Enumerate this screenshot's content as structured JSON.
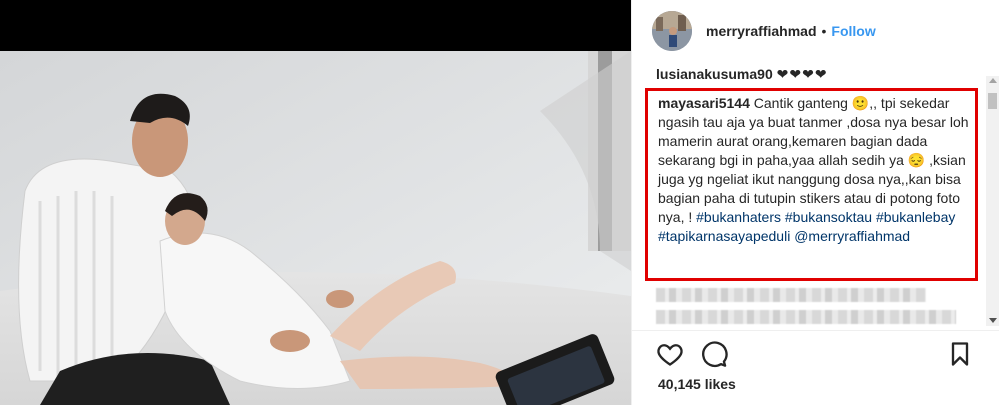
{
  "post": {
    "username": "merryraffiahmad",
    "separator": "•",
    "follow_label": "Follow",
    "likes_text": "40,145 likes"
  },
  "comments": {
    "partial_top": {
      "user": "lusianakusuma90",
      "hearts": "❤❤❤❤"
    },
    "highlighted": {
      "user": "mayasari5144",
      "text": "Cantik ganteng 🙂,, tpi sekedar ngasih tau aja ya buat tanmer ,dosa nya besar loh mamerin aurat orang,kemaren bagian dada sekarang bgi in paha,yaa allah sedih ya 😔 ,ksian juga yg ngeliat ikut nanggung dosa nya,,kan bisa bagian paha di tutupin stikers atau di potong foto nya, !",
      "hashtags": [
        "#bukanhaters",
        "#bukansoktau",
        "#bukanlebay",
        "#tapikarnasayapeduli"
      ],
      "mention": "@merryraffiahmad"
    }
  },
  "icons": {
    "like": "heart-icon",
    "comment": "comment-icon",
    "save": "bookmark-icon"
  },
  "colors": {
    "highlight_border": "#e00000",
    "link": "#003569",
    "follow": "#3897f0"
  }
}
